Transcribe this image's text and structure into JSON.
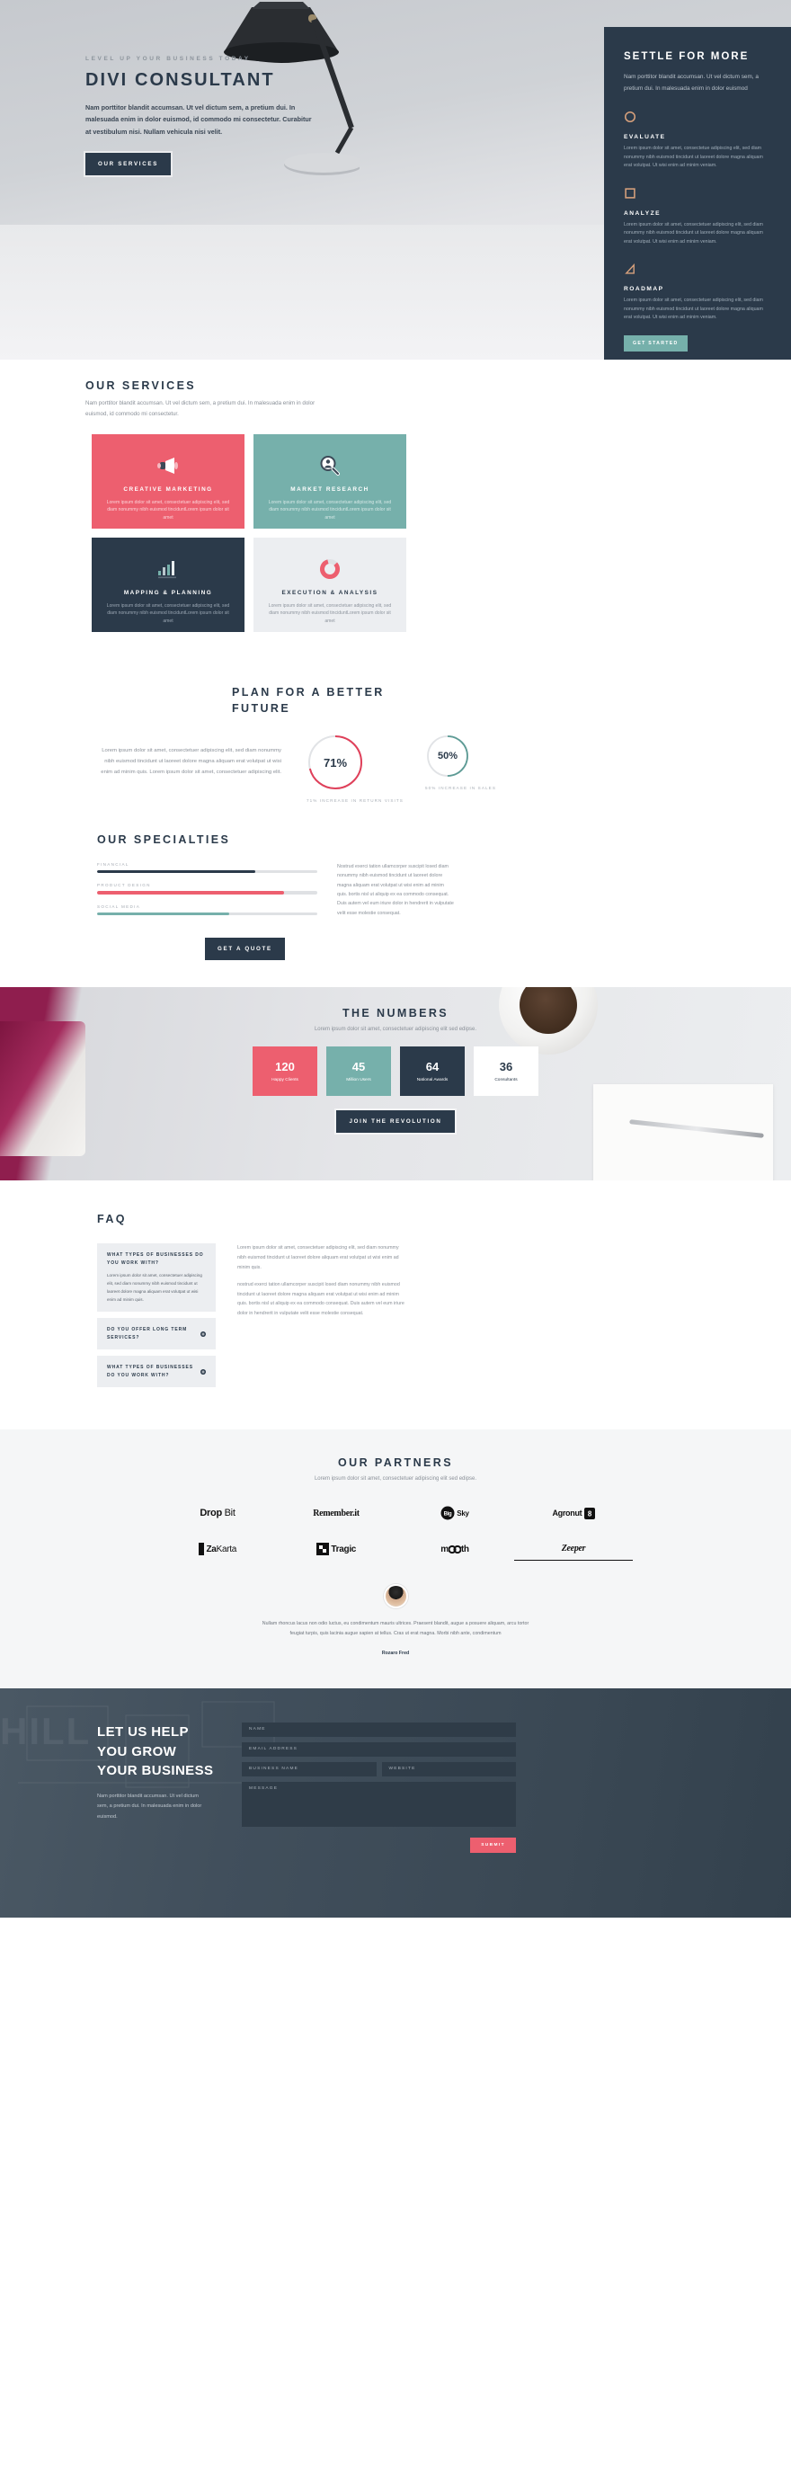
{
  "hero": {
    "eyebrow": "LEVEL UP YOUR BUSINESS TODAY",
    "title": "DIVI CONSULTANT",
    "paragraph": "Nam porttitor blandit accumsan. Ut vel dictum sem, a pretium dui. In malesuada enim in dolor euismod, id commodo mi consectetur. Curabitur at vestibulum nisi. Nullam vehicula nisi velit.",
    "button": "OUR SERVICES"
  },
  "side_panel": {
    "title": "SETTLE FOR MORE",
    "paragraph": "Nam porttitor blandit accumsan. Ut vel dictum sem, a pretium dui. In malesuada enim in dolor euismod",
    "accent_color": "#d8a17c",
    "background_color": "#2b3a4a",
    "blocks": [
      {
        "icon": "circle-outline-icon",
        "heading": "EVALUATE",
        "text": "Lorem ipsum dolor sit amet, consectetue adipiscing elit, sed diam nonummy nibh euismod tincidunt ut laoreet dolore magna aliquam erat volutpat. Ut wisi enim ad minim veniam."
      },
      {
        "icon": "square-outline-icon",
        "heading": "ANALYZE",
        "text": "Lorem ipsum dolor sit amet, consectetuer adipiscing elit, sed diam nonummy nibh euismod tincidunt ut laoreet dolore magna aliquam erat volutpat. Ut wisi enim ad minim veniam."
      },
      {
        "icon": "triangle-outline-icon",
        "heading": "ROADMAP",
        "text": "Lorem ipsum dolor sit amet, consectetuer adipiscing elit, sed diam nonummy nibh euismod tincidunt ut laoreet dolore magna aliquam erat volutpat. Ut wisi enim ad minim veniam."
      }
    ],
    "button": "GET STARTED"
  },
  "services": {
    "title": "OUR SERVICES",
    "subtitle": "Nam porttitor blandit accumsan. Ut vel dictum sem, a pretium dui. In malesuada enim in dolor euismod, id commodo mi consectetur.",
    "cards": [
      {
        "icon": "megaphone-icon",
        "title": "CREATIVE MARKETING",
        "text": "Lorem ipsum dolor sit amet, consectetuer adipiscing elit, sed diam nonummy nibh euismod tinciduntLorem ipsum dolor sit amet",
        "color": "#ed5f6f"
      },
      {
        "icon": "magnifier-person-icon",
        "title": "MARKET RESEARCH",
        "text": "Lorem ipsum dolor sit amet, consectetuer adipiscing elit, sed diam nonummy nibh euismod tinciduntLorem ipsum dolor sit amet",
        "color": "#76b0ab"
      },
      {
        "icon": "bar-chart-icon",
        "title": "MAPPING & PLANNING",
        "text": "Lorem ipsum dolor sit amet, consectetuer adipiscing elit, sed diam nonummy nibh euismod tinciduntLorem ipsum dolor sit amet",
        "color": "#2b3a4a"
      },
      {
        "icon": "donut-chart-icon",
        "title": "EXECUTION & ANALYSIS",
        "text": "Lorem ipsum dolor sit amet, consectetuer adipiscing elit, sed diam nonummy nibh euismod tinciduntLorem ipsum dolor sit amet",
        "color": "#eceef1"
      }
    ]
  },
  "plan": {
    "title": "PLAN FOR A BETTER FUTURE",
    "paragraph": "Lorem ipsum dolor sit amet, consectetuer adipiscing elit, sed diam nonummy nibh euismod tincidunt ut laoreet dolore magna aliquam erat volutpat ut wisi enim ad minim quis. Lorem ipsum dolor sit amet, consectetuer adipiscing elit."
  },
  "specialties": {
    "title": "OUR SPECIALTIES",
    "bars": [
      {
        "label": "FINANCIAL",
        "value": 72,
        "color": "#2b3a4a"
      },
      {
        "label": "PRODUCT DESIGN",
        "value": 85,
        "color": "#ed5f6f"
      },
      {
        "label": "SOCIAL MEDIA",
        "value": 60,
        "color": "#76b0ab"
      }
    ],
    "paragraph": "Nostrud exerci tation ullamcorper suscipit losed diam nonummy nibh euismod tincidunt ut laoreet dolore magna aliquam erat volutpat ut wisi enim ad minim quis. bortis nisl ut aliquip ex ea commodo consequat. Duis autem vel eum iriure dolor in hendrerit in vulputate velit esse molestie consequat.",
    "button": "GET A QUOTE"
  },
  "numbers": {
    "title": "THE NUMBERS",
    "subtitle": "Lorem ipsum dolor sit amet, consectetuer adipiscing elit sed edipse.",
    "items": [
      {
        "value": "120",
        "label": "Happy Clients",
        "color": "#ed5f6f"
      },
      {
        "value": "45",
        "label": "Million Users",
        "color": "#76b0ab"
      },
      {
        "value": "64",
        "label": "National Awards",
        "color": "#2b3a4a"
      },
      {
        "value": "36",
        "label": "Consultants",
        "color": "#ffffff"
      }
    ],
    "button": "JOIN THE REVOLUTION"
  },
  "faq": {
    "title": "FAQ",
    "items": [
      {
        "question": "WHAT TYPES OF BUSINESSES DO YOU WORK WITH?",
        "answer": "Lorem ipsum dolor sit amet, consectetuer adipiscing elit, sed diam nonummy nibh euismod tincidunt ut laoreet dolore magna aliquam erat volutpat ut wisi enim ad minim quis.",
        "open": true
      },
      {
        "question": "DO YOU OFFER LONG TERM SERVICES?",
        "answer": "",
        "open": false
      },
      {
        "question": "WHAT TYPES OF BUSINESSES DO YOU WORK WITH?",
        "answer": "",
        "open": false
      }
    ],
    "body_p1": "Lorem ipsum dolor sit amet, consectetuer adipiscing elit, sed diam nonummy nibh euismod tincidunt ut laoreet dolore aliquam erat volutpat ut wisi enim ad minim quis.",
    "body_p2": "nostrud exerci tation ullamcorper suscipit losed diam nonummy nibh euismod tincidunt ut laoreet dolore magna aliquam erat volutpat ut wisi enim ad minim quis. bortis nisl ut aliquip ex ea commodo consequat. Duis autem vel eum iriure dolor in hendrerit in vulputate velit esse molestie consequat."
  },
  "partners": {
    "title": "OUR PARTNERS",
    "subtitle": "Lorem ipsum dolor sit amet, consectetuer adipiscing elit sed edipse.",
    "logos": [
      "Drop Bit",
      "Remember.it",
      "Big Sky",
      "Agronut 8",
      "ZaKarta",
      "Tragic",
      "mooth",
      "Zeeper"
    ],
    "testimonial": "Nullam rhoncus lacus non odio luctus, eu condimentum mauris ultrices. Praesent blandit, augue a posuere aliquam, arcu tortor feugiat turpis, quis lacinia augue sapien at tellus. Cras ut erat magna. Morbi nibh ante, condimentum",
    "testimonial_author": "Rozaro Fred"
  },
  "contact": {
    "ghost_text": "HILL",
    "heading": "LET US HELP YOU GROW YOUR BUSINESS",
    "paragraph": "Nam porttitor blandit accumsan. Ut vel dictum sem, a pretium dui. In malesuada enim in dolor euismod.",
    "fields": {
      "name": "NAME",
      "email": "EMAIL ADDRESS",
      "business": "BUSINESS NAME",
      "website": "WEBSITE",
      "message": "MESSAGE"
    },
    "submit": "SUBMIT"
  },
  "chart_data": [
    {
      "type": "pie",
      "title": "71% INCREASE IN RETURN VISITS",
      "value": 71,
      "max": 100,
      "display": "71%",
      "caption": "71% INCREASE IN RETURN VISITS",
      "color": "#e0405a",
      "track_color": "#e1e3e6"
    },
    {
      "type": "pie",
      "title": "50% INCREASE IN SALES",
      "value": 50,
      "max": 100,
      "display": "50%",
      "caption": "50% INCREASE IN SALES",
      "color": "#5d9b95",
      "track_color": "#e1e3e6"
    },
    {
      "type": "bar",
      "title": "OUR SPECIALTIES",
      "categories": [
        "FINANCIAL",
        "PRODUCT DESIGN",
        "SOCIAL MEDIA"
      ],
      "values": [
        72,
        85,
        60
      ],
      "ylim": [
        0,
        100
      ],
      "xlabel": "",
      "ylabel": "",
      "orientation": "horizontal"
    },
    {
      "type": "table",
      "title": "THE NUMBERS",
      "categories": [
        "Happy Clients",
        "Million Users",
        "National Awards",
        "Consultants"
      ],
      "values": [
        120,
        45,
        64,
        36
      ]
    }
  ]
}
